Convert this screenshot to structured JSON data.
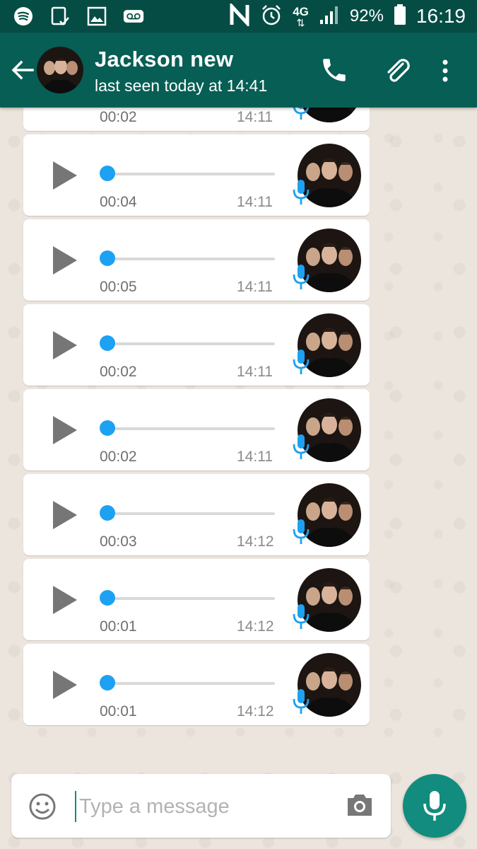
{
  "status_bar": {
    "battery": "92%",
    "time": "16:19",
    "network": "4G",
    "left_icons": [
      "spotify-icon",
      "clipboard-check-icon",
      "image-icon",
      "voicemail-icon"
    ],
    "right_icons": [
      "nfc-icon",
      "alarm-icon",
      "data-arrows-icon",
      "signal-icon",
      "battery-icon"
    ]
  },
  "header": {
    "contact_name": "Jackson new",
    "last_seen": "last seen today at 14:41",
    "icons": [
      "back-arrow-icon",
      "contact-avatar",
      "phone-icon",
      "paperclip-icon",
      "more-vert-icon"
    ]
  },
  "messages": [
    {
      "duration": "00:02",
      "time": "14:11",
      "progress": 0
    },
    {
      "duration": "00:04",
      "time": "14:11",
      "progress": 0
    },
    {
      "duration": "00:05",
      "time": "14:11",
      "progress": 0
    },
    {
      "duration": "00:02",
      "time": "14:11",
      "progress": 0
    },
    {
      "duration": "00:02",
      "time": "14:11",
      "progress": 0
    },
    {
      "duration": "00:03",
      "time": "14:12",
      "progress": 0
    },
    {
      "duration": "00:01",
      "time": "14:12",
      "progress": 0
    },
    {
      "duration": "00:01",
      "time": "14:12",
      "progress": 0
    }
  ],
  "input": {
    "placeholder": "Type a message",
    "value": ""
  },
  "colors": {
    "status_bar": "#054d44",
    "app_bar": "#075e54",
    "accent": "#128c7e",
    "voice_dot": "#1da1f2",
    "mic_badge": "#1da1f2"
  }
}
